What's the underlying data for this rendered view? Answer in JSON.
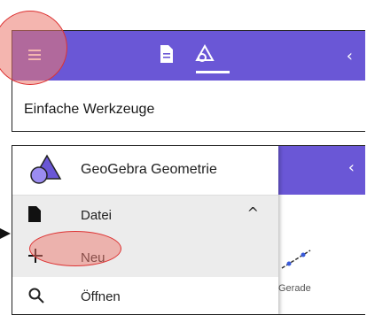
{
  "top_panel": {
    "subtitle": "Einfache Werkzeuge",
    "accent_color": "#6a57d6",
    "icons": [
      "menu-icon",
      "document-icon",
      "geometry-tools-icon",
      "chevron-left-icon"
    ],
    "collapse_glyph": "‹"
  },
  "bottom_panel": {
    "app_title": "GeoGebra Geometrie",
    "menu_items": {
      "datei": "Datei",
      "neu": "Neu",
      "oeffnen": "Öffnen"
    },
    "background_tool_label": "Gerade",
    "collapse_glyph": "‹",
    "caret_glyph": "^",
    "plus_glyph": "+"
  }
}
